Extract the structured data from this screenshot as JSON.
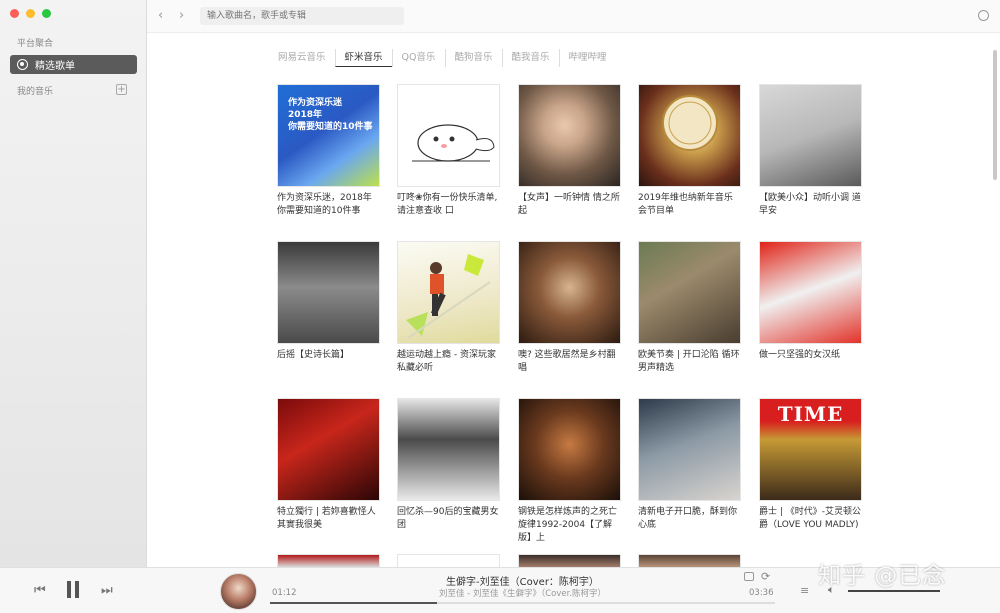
{
  "sidebar": {
    "platform_header": "平台聚合",
    "active_item": "精选歌单",
    "my_music": "我的音乐"
  },
  "topbar": {
    "back": "‹",
    "forward": "›",
    "search_placeholder": "输入歌曲名，歌手或专辑"
  },
  "tabs": [
    "网易云音乐",
    "虾米音乐",
    "QQ音乐",
    "酷狗音乐",
    "酷我音乐",
    "哔哩哔哩"
  ],
  "active_tab": "虾米音乐",
  "playlists": [
    {
      "title": "作为资深乐迷，2018年你需要知道的10件事",
      "cover_text": "作为资深乐迷\n2018年\n你需要知道的10件事"
    },
    {
      "title": "叮咚❀你有一份快乐清单,请注意查收 口"
    },
    {
      "title": "【女声】一听钟情 情之所起"
    },
    {
      "title": "2019年维也纳新年音乐会节目单"
    },
    {
      "title": "【欧美小众】动听小调 道早安"
    },
    {
      "title": "后摇【史诗长篇】"
    },
    {
      "title": "越运动越上瘾 - 资深玩家私藏必听"
    },
    {
      "title": "噢? 这些歌居然是乡村翻唱"
    },
    {
      "title": "欧美节奏 | 开口沦陷 循环男声精选"
    },
    {
      "title": "做一只坚强的女汉纸"
    },
    {
      "title": "特立獨行 | 若妳喜歡怪人 其實我很美"
    },
    {
      "title": "回忆杀—90后的宝藏男女团"
    },
    {
      "title": "钢铁是怎样炼声的之死亡旋律1992-2004【了解版】上"
    },
    {
      "title": "清新电子开口脆，酥到你心底"
    },
    {
      "title": "爵士 | 《时代》-艾灵顿公爵（LOVE YOU MADLY)",
      "cover_text": "TIME"
    }
  ],
  "player": {
    "song_title": "生僻字-刘至佳（Cover：陈柯宇）",
    "song_sub": "刘至佳 - 刘至佳《生僻字》（Cover.陈柯宇）",
    "time_elapsed": "01:12",
    "time_total": "03:36",
    "progress": 0.33,
    "volume": 1.0
  },
  "watermark": "知乎 @已念",
  "colors": {
    "active_sidebar": "#5b5b5b",
    "tab_active": "#333333",
    "tab_inactive": "#aaaaaa"
  }
}
